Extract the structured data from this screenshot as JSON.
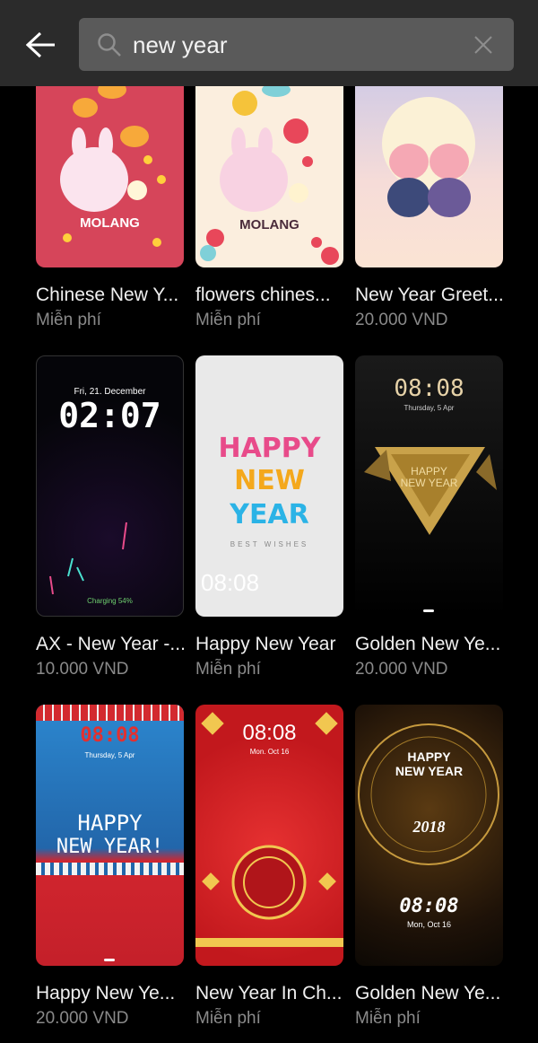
{
  "search": {
    "query": "new year"
  },
  "themes": [
    {
      "title": "Chinese New Y...",
      "price": "Miễn phí",
      "brand": "MOLANG"
    },
    {
      "title": "flowers chines...",
      "price": "Miễn phí",
      "brand": "MOLANG"
    },
    {
      "title": "New Year Greet...",
      "price": "20.000 VND"
    },
    {
      "title": "AX - New Year -...",
      "price": "10.000 VND",
      "clock": "02:07",
      "date": "Fri, 21. December",
      "status": "Charging 54%"
    },
    {
      "title": "Happy New Year",
      "price": "Miễn phí",
      "line1": "HAPPY",
      "line2": "NEW",
      "line3": "YEAR",
      "subtitle": "BEST WISHES",
      "clock": "08:08"
    },
    {
      "title": "Golden New Ye...",
      "price": "20.000 VND",
      "clock": "08:08",
      "date": "Thursday, 5 Apr",
      "line1": "HAPPY",
      "line2": "NEW YEAR"
    },
    {
      "title": "Happy New Ye...",
      "price": "20.000 VND",
      "clock": "08:08",
      "date": "Thursday, 5 Apr",
      "line1": "HAPPY",
      "line2": "NEW YEAR!"
    },
    {
      "title": "New Year In Ch...",
      "price": "Miễn phí",
      "clock": "08:08",
      "date": "Mon. Oct 16"
    },
    {
      "title": "Golden New Ye...",
      "price": "Miễn phí",
      "line1": "HAPPY",
      "line2": "NEW YEAR",
      "year": "2018",
      "clock": "08:08",
      "date": "Mon, Oct 16"
    }
  ],
  "colors": {
    "topbar": "#2b2b2b",
    "search_box": "#5a5a5a",
    "price": "#8a8a8a"
  }
}
